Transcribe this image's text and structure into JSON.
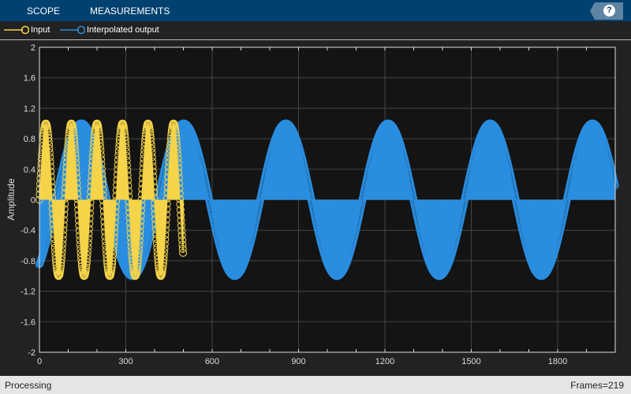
{
  "toolbar": {
    "tabs": [
      "SCOPE",
      "MEASUREMENTS"
    ],
    "help_label": "?"
  },
  "legend": [
    {
      "label": "Input",
      "color": "#f5d44a"
    },
    {
      "label": "Interpolated output",
      "color": "#2a8ee0"
    }
  ],
  "status": {
    "left": "Processing",
    "right": "Frames=219"
  },
  "chart_data": {
    "type": "stem",
    "title": "",
    "xlabel": "",
    "ylabel": "Amplitude",
    "xlim": [
      0,
      2000
    ],
    "ylim": [
      -2,
      2
    ],
    "xticks": [
      0,
      300,
      600,
      900,
      1200,
      1500,
      1800
    ],
    "yticks": [
      -2,
      -1.6,
      -1.2,
      -0.8,
      -0.4,
      0,
      0.4,
      0.8,
      1.2,
      1.6,
      2
    ],
    "ytick_labels": [
      "-2",
      "-1.6",
      "-1.2",
      "-0.8",
      "-0.4",
      "0",
      "0.4",
      "0.8",
      "1.2",
      "1.6",
      "2"
    ],
    "grid": true,
    "legend_placement": "top-left",
    "series": [
      {
        "name": "Input",
        "color": "#f5d44a",
        "num_samples": 500,
        "model": "sine",
        "amplitude": 1.0,
        "period_samples": 88.75,
        "phase_offset_samples": 0
      },
      {
        "name": "Interpolated output",
        "color": "#2a8ee0",
        "num_samples": 2000,
        "model": "sine",
        "amplitude": 1.0,
        "period_samples": 355,
        "phase_offset_samples": 412
      }
    ]
  }
}
